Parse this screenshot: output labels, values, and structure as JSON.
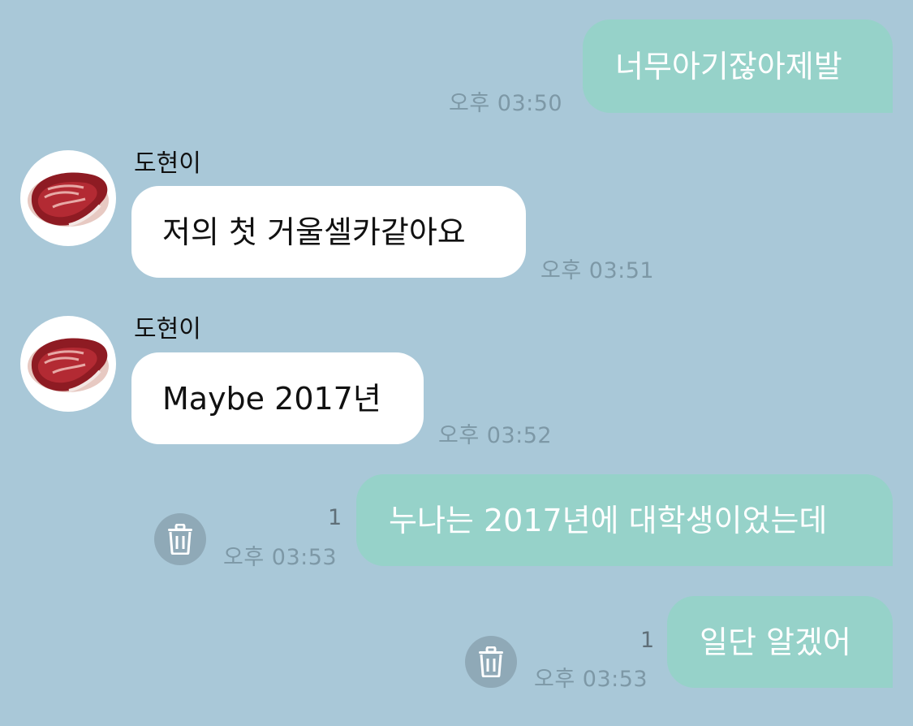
{
  "messages": [
    {
      "side": "sent",
      "text": "너무아기잖아제발",
      "time": "오후 03:50"
    },
    {
      "side": "recv",
      "sender": "도현이",
      "text": "저의 첫 거울셀카같아요",
      "time": "오후 03:51",
      "avatar": "steak-icon"
    },
    {
      "side": "recv",
      "sender": "도현이",
      "text": "Maybe 2017년",
      "time": "오후 03:52",
      "avatar": "steak-icon"
    },
    {
      "side": "sent",
      "text": "누나는 2017년에 대학생이었는데",
      "time": "오후 03:53",
      "unread": "1",
      "action_icon": "trash-icon"
    },
    {
      "side": "sent",
      "text": "일단 알겠어",
      "time": "오후 03:53",
      "unread": "1",
      "action_icon": "trash-icon"
    }
  ],
  "colors": {
    "background": "#a9c8d8",
    "sent_bubble": "#96d2c9",
    "recv_bubble": "#ffffff",
    "time_text": "#7d98a6"
  }
}
